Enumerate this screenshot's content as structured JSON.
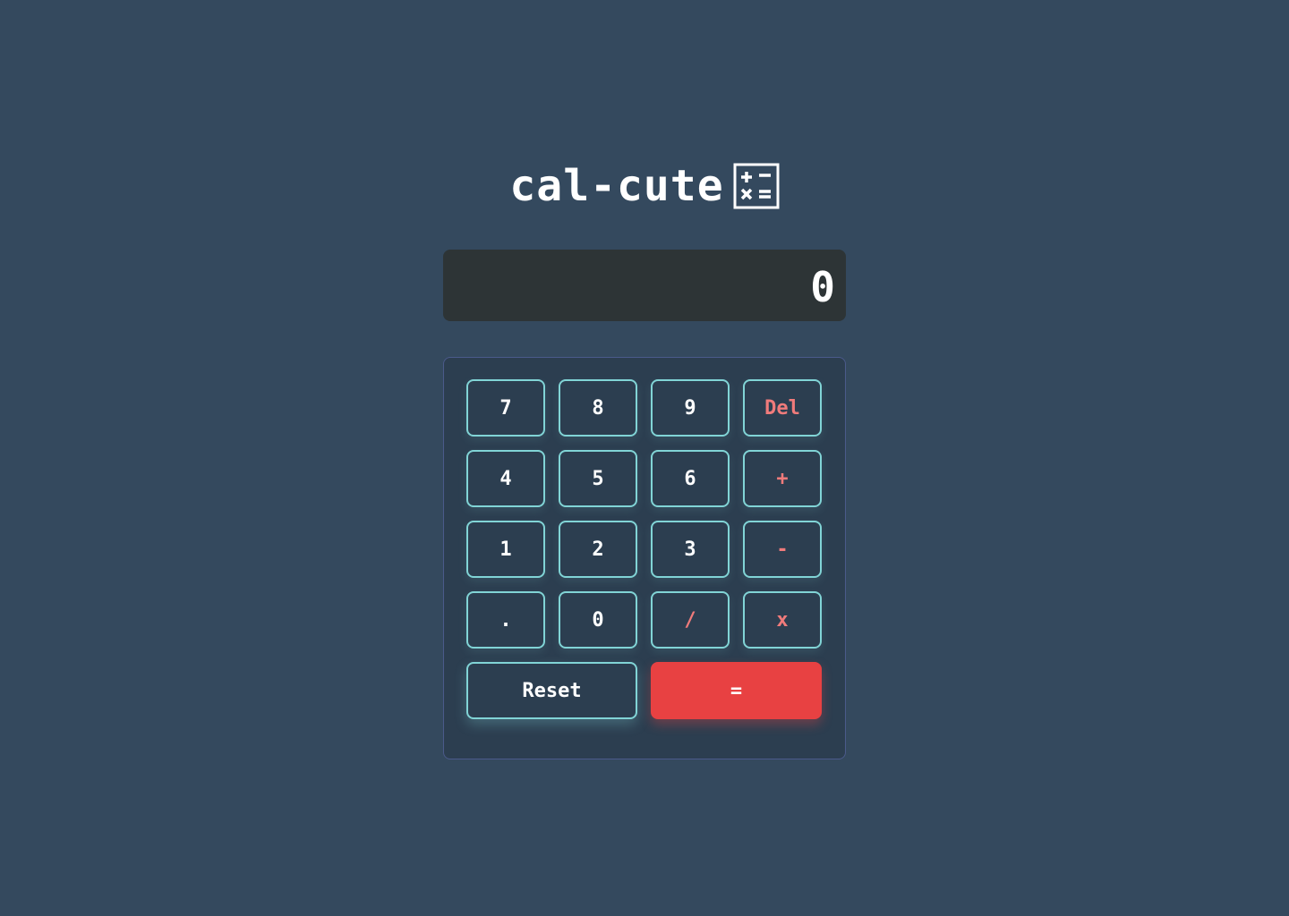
{
  "header": {
    "title": "cal-cute",
    "icon": "calculator-icon"
  },
  "display": {
    "value": "0"
  },
  "colors": {
    "background": "#34495e",
    "display_bg": "#2d3436",
    "keypad_bg": "#2c3e50",
    "key_border": "#81d4d6",
    "operator_text": "#f07b7b",
    "equals_bg": "#e84142"
  },
  "keys": {
    "k7": "7",
    "k8": "8",
    "k9": "9",
    "del": "Del",
    "k4": "4",
    "k5": "5",
    "k6": "6",
    "plus": "+",
    "k1": "1",
    "k2": "2",
    "k3": "3",
    "minus": "-",
    "dot": ".",
    "k0": "0",
    "divide": "/",
    "multiply": "x",
    "reset": "Reset",
    "equals": "="
  }
}
